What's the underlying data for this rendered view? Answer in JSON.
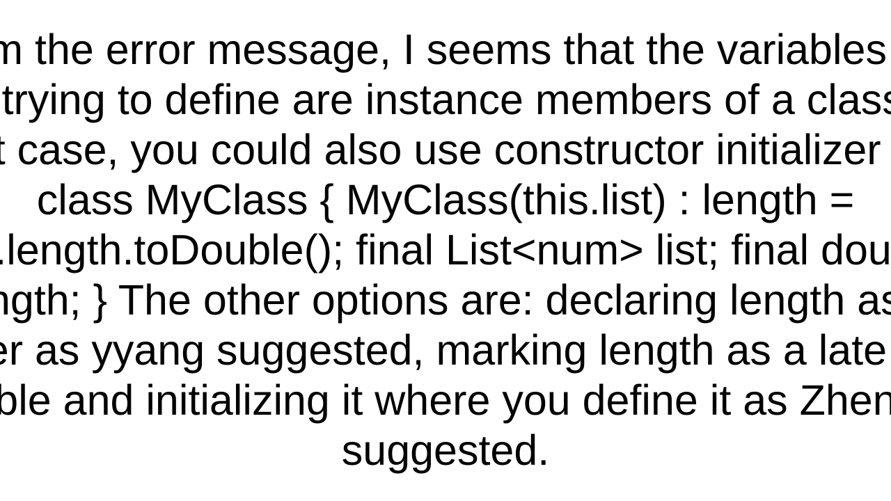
{
  "answer": {
    "full_text": "From the error message, I seems that the variables you are trying to define are instance members of a class. In that case, you could also use constructor initializer list:  class MyClass {   MyClass(this.list)       : length = list.length.toDouble();   final List<num> list;   final double length; }  The other options are:  declaring length as a getter as yyang suggested, marking length as a late final variable and initializing it where you define it as Zheng Qu suggested."
  }
}
